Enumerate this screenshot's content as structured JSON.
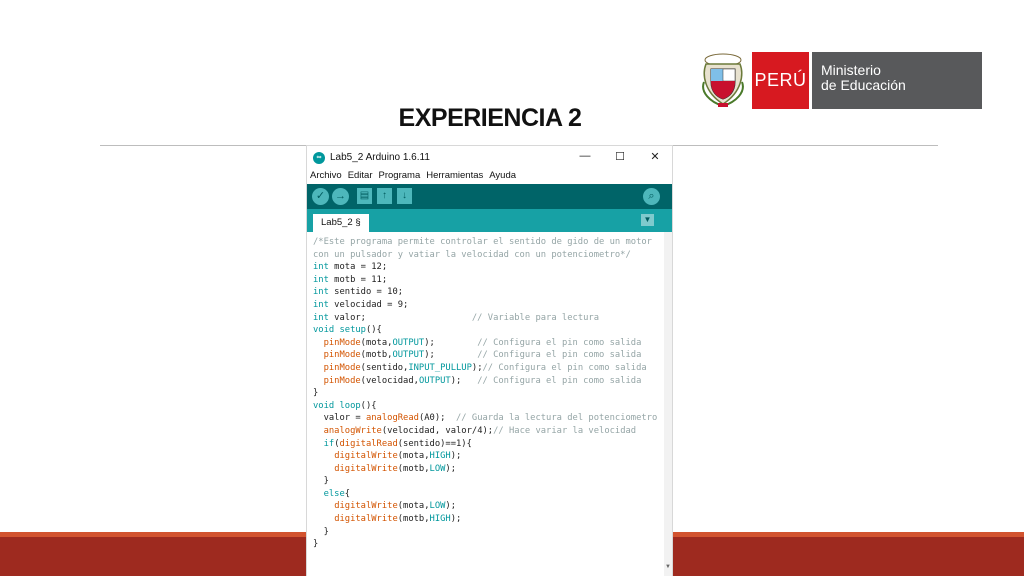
{
  "slide": {
    "title": "EXPERIENCIA 2",
    "logo_peru": "PERÚ",
    "logo_ministry_line1": "Ministerio",
    "logo_ministry_line2": "de Educación",
    "colors": {
      "band": "#9e2a1f",
      "peru_red": "#d71920",
      "ministry_gray": "#58595b"
    }
  },
  "window": {
    "title": "Lab5_2 Arduino 1.6.11",
    "controls": {
      "minimize": "—",
      "maximize": "☐",
      "close": "✕"
    },
    "menu": [
      "Archivo",
      "Editar",
      "Programa",
      "Herramientas",
      "Ayuda"
    ],
    "toolbar": {
      "verify_icon": "check-icon",
      "upload_icon": "arrow-right-icon",
      "new_icon": "new-file-icon",
      "open_icon": "arrow-up-icon",
      "save_icon": "arrow-down-icon",
      "serial_icon": "magnifier-icon"
    },
    "tab_label": "Lab5_2 §",
    "colors": {
      "toolbar": "#006468",
      "tabstrip": "#17a1a5",
      "keyword": "#00979c",
      "function": "#d35400",
      "comment": "#95a5a6"
    }
  },
  "code": [
    [
      [
        "c",
        "/*Este programa permite controlar el sentido de gido de un motor"
      ]
    ],
    [
      [
        "c",
        "con un pulsador y vatiar la velocidad con un potenciometro*/"
      ]
    ],
    [
      [
        "k",
        "int"
      ],
      [
        "",
        " mota = 12;"
      ]
    ],
    [
      [
        "k",
        "int"
      ],
      [
        "",
        " motb = 11;"
      ]
    ],
    [
      [
        "k",
        "int"
      ],
      [
        "",
        " sentido = 10;"
      ]
    ],
    [
      [
        "k",
        "int"
      ],
      [
        "",
        " velocidad = 9;"
      ]
    ],
    [
      [
        "k",
        "int"
      ],
      [
        "",
        " valor;                    "
      ],
      [
        "c",
        "// Variable para lectura"
      ]
    ],
    [
      [
        "k",
        "void"
      ],
      [
        "",
        " "
      ],
      [
        "k",
        "setup"
      ],
      [
        "",
        "(){"
      ]
    ],
    [
      [
        "",
        "  "
      ],
      [
        "f",
        "pinMode"
      ],
      [
        "",
        "(mota,"
      ],
      [
        "k",
        "OUTPUT"
      ],
      [
        "",
        ");        "
      ],
      [
        "c",
        "// Configura el pin como salida"
      ]
    ],
    [
      [
        "",
        "  "
      ],
      [
        "f",
        "pinMode"
      ],
      [
        "",
        "(motb,"
      ],
      [
        "k",
        "OUTPUT"
      ],
      [
        "",
        ");        "
      ],
      [
        "c",
        "// Configura el pin como salida"
      ]
    ],
    [
      [
        "",
        "  "
      ],
      [
        "f",
        "pinMode"
      ],
      [
        "",
        "(sentido,"
      ],
      [
        "k",
        "INPUT_PULLUP"
      ],
      [
        "",
        ");"
      ],
      [
        "c",
        "// Configura el pin como salida"
      ]
    ],
    [
      [
        "",
        "  "
      ],
      [
        "f",
        "pinMode"
      ],
      [
        "",
        "(velocidad,"
      ],
      [
        "k",
        "OUTPUT"
      ],
      [
        "",
        ");   "
      ],
      [
        "c",
        "// Configura el pin como salida"
      ]
    ],
    [
      [
        "",
        "}"
      ]
    ],
    [
      [
        "k",
        "void"
      ],
      [
        "",
        " "
      ],
      [
        "k",
        "loop"
      ],
      [
        "",
        "(){"
      ]
    ],
    [
      [
        "",
        "  valor = "
      ],
      [
        "f",
        "analogRead"
      ],
      [
        "",
        "(A0);  "
      ],
      [
        "c",
        "// Guarda la lectura del potenciometro"
      ]
    ],
    [
      [
        "",
        "  "
      ],
      [
        "f",
        "analogWrite"
      ],
      [
        "",
        "(velocidad, valor/4);"
      ],
      [
        "c",
        "// Hace variar la velocidad"
      ]
    ],
    [
      [
        "",
        "  "
      ],
      [
        "k",
        "if"
      ],
      [
        "",
        "("
      ],
      [
        "f",
        "digitalRead"
      ],
      [
        "",
        "(sentido)==1){"
      ]
    ],
    [
      [
        "",
        "    "
      ],
      [
        "f",
        "digitalWrite"
      ],
      [
        "",
        "(mota,"
      ],
      [
        "k",
        "HIGH"
      ],
      [
        "",
        ");"
      ]
    ],
    [
      [
        "",
        "    "
      ],
      [
        "f",
        "digitalWrite"
      ],
      [
        "",
        "(motb,"
      ],
      [
        "k",
        "LOW"
      ],
      [
        "",
        ");"
      ]
    ],
    [
      [
        "",
        "  }"
      ]
    ],
    [
      [
        "",
        "  "
      ],
      [
        "k",
        "else"
      ],
      [
        "",
        "{"
      ]
    ],
    [
      [
        "",
        "    "
      ],
      [
        "f",
        "digitalWrite"
      ],
      [
        "",
        "(mota,"
      ],
      [
        "k",
        "LOW"
      ],
      [
        "",
        ");"
      ]
    ],
    [
      [
        "",
        "    "
      ],
      [
        "f",
        "digitalWrite"
      ],
      [
        "",
        "(motb,"
      ],
      [
        "k",
        "HIGH"
      ],
      [
        "",
        ");"
      ]
    ],
    [
      [
        "",
        "  }"
      ]
    ],
    [
      [
        "",
        "}"
      ]
    ]
  ]
}
